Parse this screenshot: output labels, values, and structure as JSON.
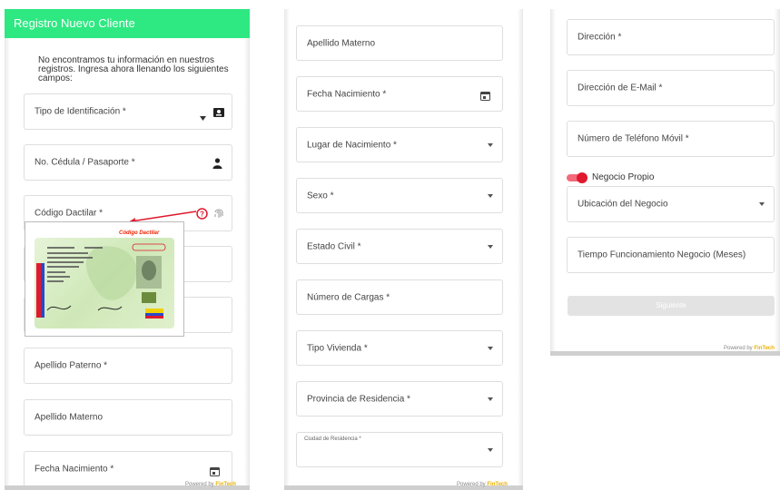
{
  "colors": {
    "header_bg": "#2ee882",
    "accent_red": "#e0192e",
    "toggle_track": "#f36a7a",
    "border": "#dedede",
    "brand": "#e8b000"
  },
  "panel1": {
    "title": "Registro Nuevo Cliente",
    "intro": "No encontramos tu información en nuestros registros. Ingresa ahora llenando los siguientes campos:",
    "fields": {
      "tipo_identificacion": "Tipo de Identificación *",
      "cedula": "No. Cédula / Pasaporte *",
      "codigo_dactilar": "Código Dactilar *",
      "apellido_paterno": "Apellido Paterno *",
      "apellido_materno": "Apellido Materno",
      "fecha_nacimiento": "Fecha Nacimiento *"
    },
    "card_callout": "Código Dactilar",
    "icons": {
      "tipo": "id-card-icon",
      "cedula": "person-icon",
      "help": "help-circle-icon",
      "fingerprint": "fingerprint-icon",
      "calendar": "calendar-icon"
    },
    "powered_prefix": "Powered by",
    "powered_brand": "FinTech"
  },
  "panel2": {
    "fields": {
      "apellido_materno": "Apellido Materno",
      "fecha_nacimiento": "Fecha Nacimiento *",
      "lugar_nacimiento": "Lugar de Nacimiento *",
      "sexo": "Sexo *",
      "estado_civil": "Estado Civil *",
      "numero_cargas": "Número de Cargas *",
      "tipo_vivienda": "Tipo Vivienda *",
      "provincia_residencia": "Provincia de Residencia *",
      "ciudad_residencia": "Ciudad de Residencia *"
    },
    "powered_prefix": "Powered by",
    "powered_brand": "FinTech"
  },
  "panel3": {
    "fields": {
      "direccion": "Dirección *",
      "email": "Dirección de E-Mail *",
      "telefono": "Número de Teléfono Móvil *",
      "ubicacion_negocio": "Ubicación del Negocio",
      "tiempo_funcionamiento": "Tiempo Funcionamiento Negocio (Meses)"
    },
    "toggle_label": "Negocio Propio",
    "toggle_on": true,
    "next_button": "Siguiente",
    "powered_prefix": "Powered by",
    "powered_brand": "FinTech"
  }
}
